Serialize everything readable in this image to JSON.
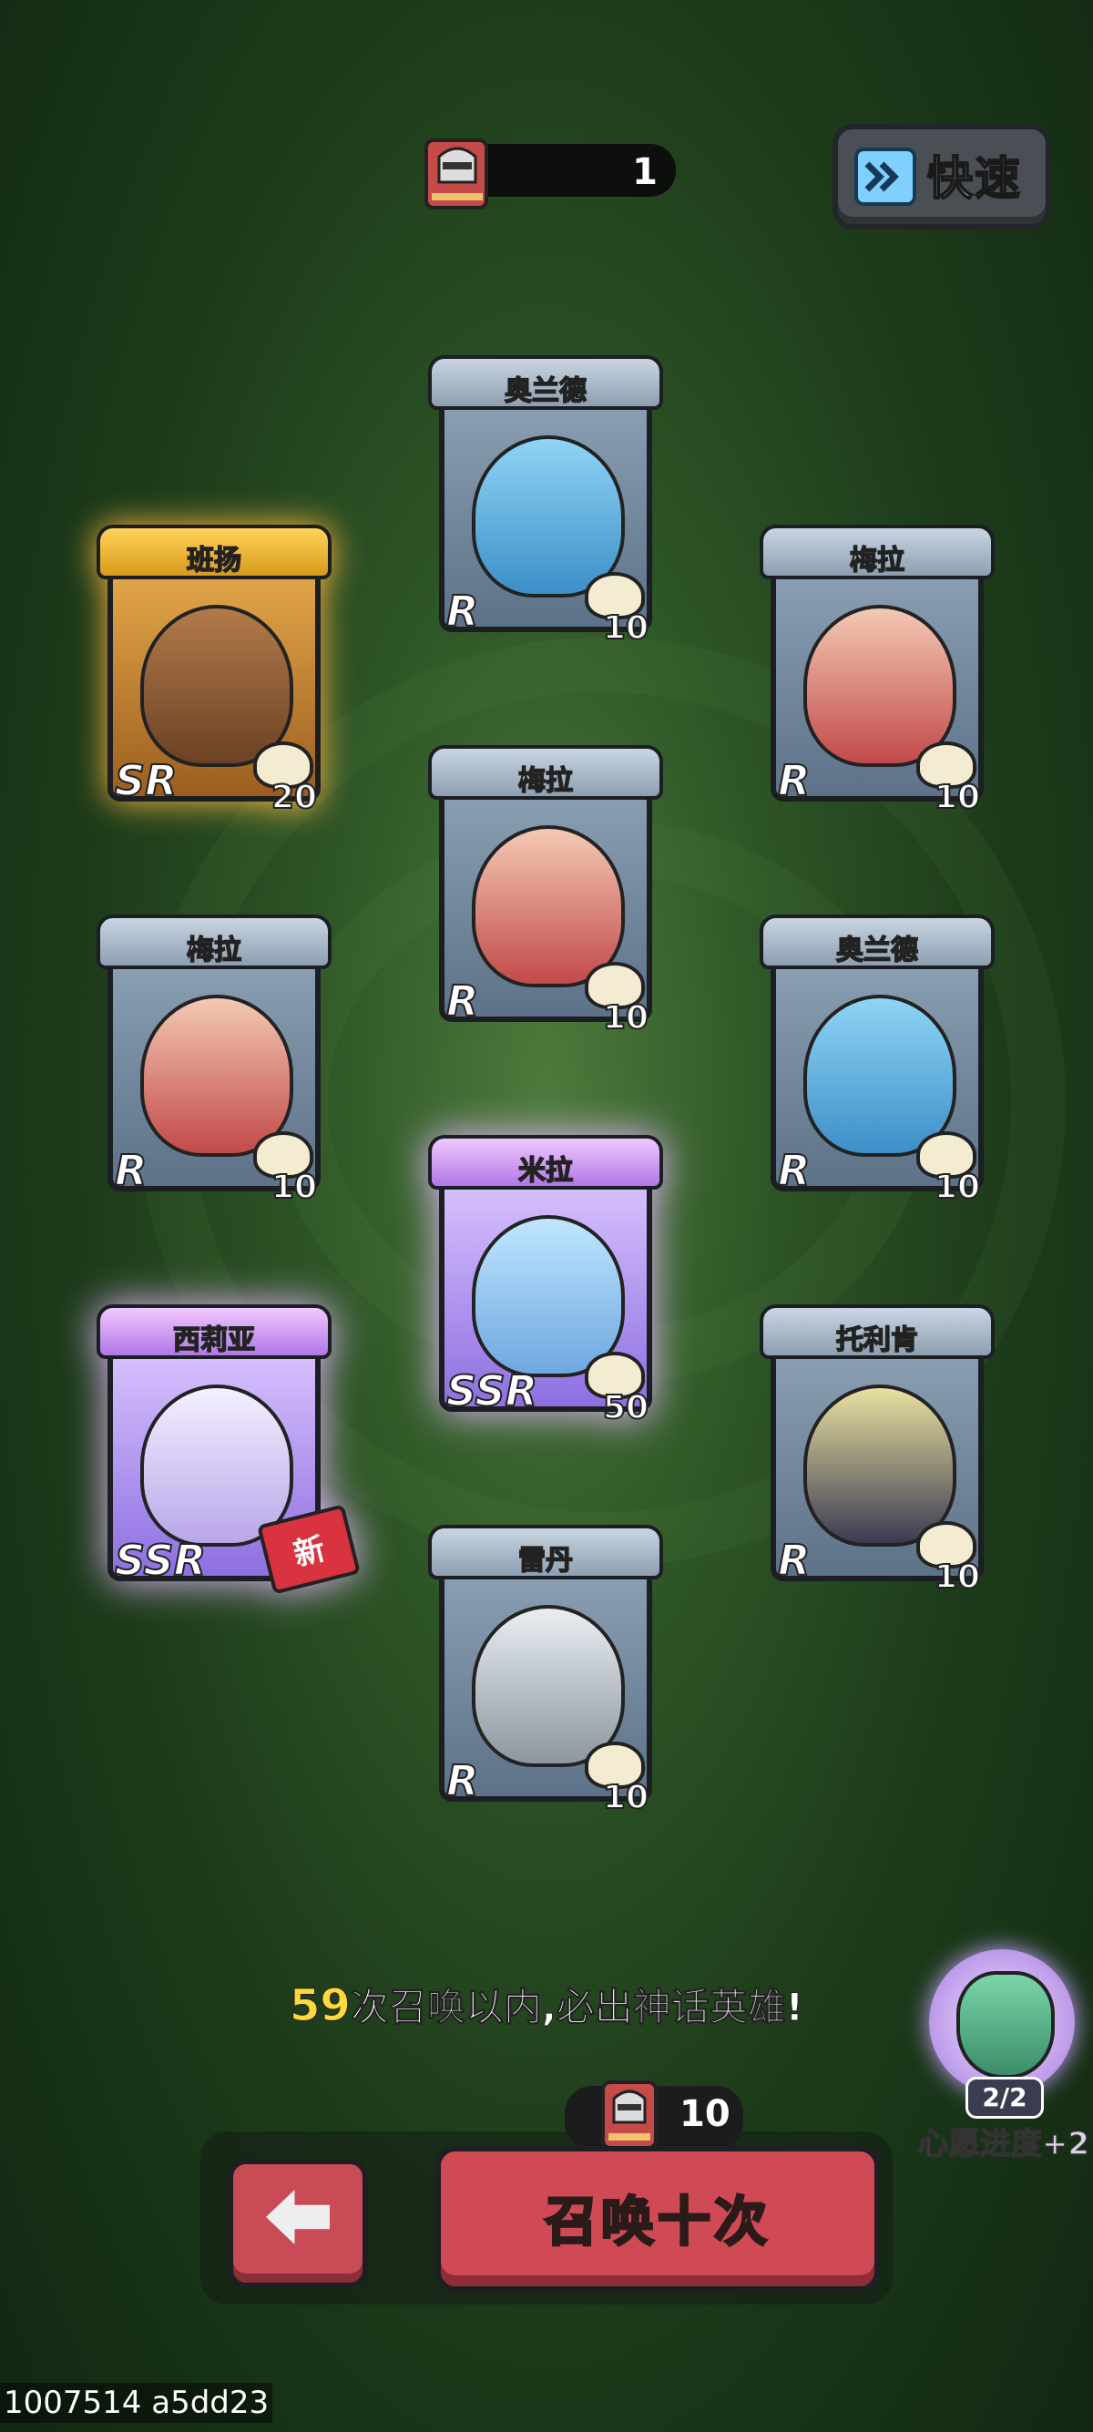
{
  "top_bar": {
    "ticket_count": "1",
    "fast_button_label": "快速"
  },
  "cards": [
    {
      "name": "奥兰德",
      "rarity": "R",
      "count": "10",
      "is_new": false
    },
    {
      "name": "班扬",
      "rarity": "SR",
      "count": "20",
      "is_new": false
    },
    {
      "name": "梅拉",
      "rarity": "R",
      "count": "10",
      "is_new": false
    },
    {
      "name": "梅拉",
      "rarity": "R",
      "count": "10",
      "is_new": false
    },
    {
      "name": "梅拉",
      "rarity": "R",
      "count": "10",
      "is_new": false
    },
    {
      "name": "奥兰德",
      "rarity": "R",
      "count": "10",
      "is_new": false
    },
    {
      "name": "米拉",
      "rarity": "SSR",
      "count": "50",
      "is_new": false
    },
    {
      "name": "西莉亚",
      "rarity": "SSR",
      "count": "",
      "is_new": true,
      "new_label": "新"
    },
    {
      "name": "托利肯",
      "rarity": "R",
      "count": "10",
      "is_new": false
    },
    {
      "name": "雷丹",
      "rarity": "R",
      "count": "10",
      "is_new": false
    }
  ],
  "hint": {
    "number": "59",
    "text": "次召唤以内,必出神话英雄!"
  },
  "wish": {
    "progress": "2/2",
    "label": "心愿进度+2"
  },
  "summon": {
    "cost": "10",
    "button_label": "召唤十次"
  },
  "build_id": "1007514 a5dd23",
  "colors": {
    "background": "#2e5526",
    "summon_button": "#d04a55",
    "hint_number": "#ffd83a"
  }
}
